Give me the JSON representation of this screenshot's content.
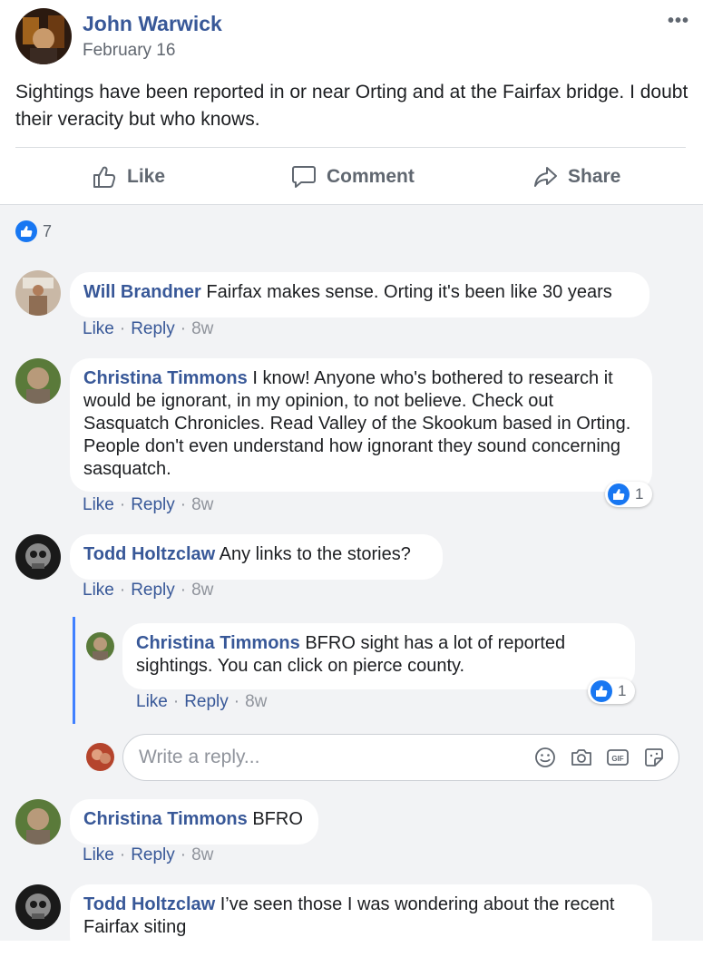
{
  "post": {
    "author": "John Warwick",
    "date": "February 16",
    "text": "Sightings have been reported in or near Orting and at the Fairfax bridge. I doubt their veracity but who knows.",
    "more_icon": "•••"
  },
  "actions": {
    "like": "Like",
    "comment": "Comment",
    "share": "Share"
  },
  "reactions": {
    "count": "7"
  },
  "comments": [
    {
      "author": "Will Brandner",
      "text": "Fairfax makes sense. Orting it's been like 30 years",
      "like": "Like",
      "reply": "Reply",
      "time": "8w"
    },
    {
      "author": "Christina Timmons",
      "text": "I know! Anyone who's bothered to research it would be ignorant, in my opinion, to not believe. Check out Sasquatch Chronicles. Read Valley of the Skookum based in Orting. People don't even understand how ignorant they sound concerning sasquatch.",
      "like": "Like",
      "reply": "Reply",
      "time": "8w",
      "reactions": "1"
    },
    {
      "author": "Todd Holtzclaw",
      "text": "Any links to the stories?",
      "like": "Like",
      "reply": "Reply",
      "time": "8w",
      "replies": [
        {
          "author": "Christina Timmons",
          "text": "BFRO sight has a lot of reported sightings. You can click on pierce county.",
          "like": "Like",
          "reply": "Reply",
          "time": "8w",
          "reactions": "1"
        }
      ]
    },
    {
      "author": "Christina Timmons",
      "text": "BFRO",
      "like": "Like",
      "reply": "Reply",
      "time": "8w"
    },
    {
      "author": "Todd Holtzclaw",
      "text": "I’ve seen those I was wondering about the recent Fairfax siting"
    }
  ],
  "reply_box": {
    "placeholder": "Write a reply..."
  },
  "icons": {
    "like": "thumbs-up-icon",
    "comment": "comment-bubble-icon",
    "share": "share-arrow-icon",
    "emoji": "emoji-icon",
    "camera": "camera-icon",
    "gif": "gif-icon",
    "sticker": "sticker-icon"
  },
  "colors": {
    "link": "#385898",
    "accent": "#1877f2",
    "muted": "#606770",
    "comment_bg": "#f2f3f5",
    "thread_line": "#4080ff"
  }
}
